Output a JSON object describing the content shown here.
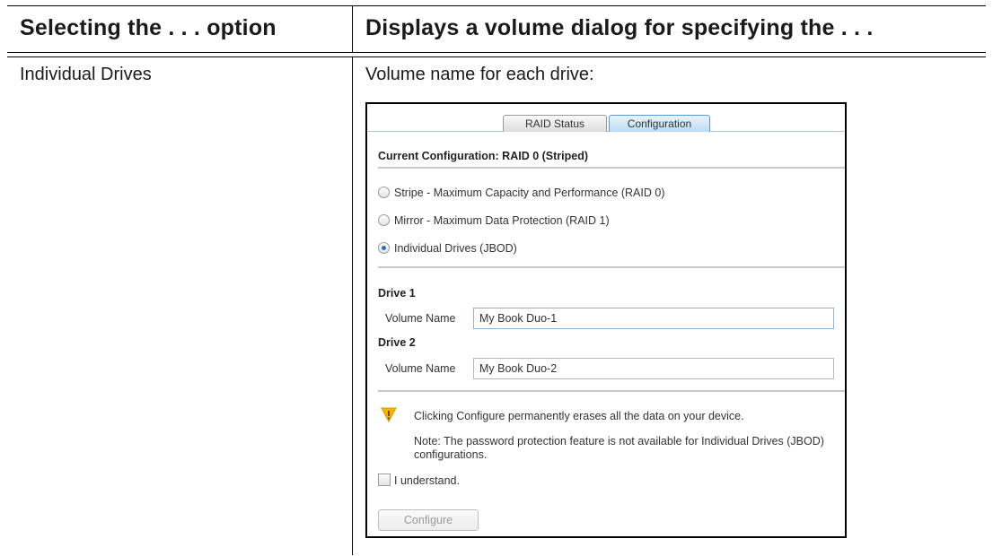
{
  "table": {
    "headers": [
      "Selecting the . . . option",
      "Displays a volume dialog for specifying the . . ."
    ],
    "row": {
      "option": "Individual Drives",
      "description": "Volume name for each drive:"
    }
  },
  "dialog": {
    "tabs": [
      {
        "label": "RAID Status",
        "active": false
      },
      {
        "label": "Configuration",
        "active": true
      }
    ],
    "current_configuration": "Current Configuration:  RAID 0 (Striped)",
    "raid_options": [
      {
        "label": "Stripe - Maximum Capacity and Performance (RAID 0)",
        "selected": false
      },
      {
        "label": "Mirror - Maximum Data Protection (RAID 1)",
        "selected": false
      },
      {
        "label": "Individual Drives (JBOD)",
        "selected": true
      }
    ],
    "drives": [
      {
        "title": "Drive 1",
        "volume_label": "Volume Name",
        "volume_value": "My Book Duo-1"
      },
      {
        "title": "Drive 2",
        "volume_label": "Volume Name",
        "volume_value": "My Book Duo-2"
      }
    ],
    "warning_icon": "warning-icon",
    "warning_color": "#f5b400",
    "warning": "Clicking Configure permanently erases all the data on your device.",
    "note": "Note: The password protection feature is not available for Individual Drives (JBOD) configurations.",
    "understand_label": "I understand.",
    "understand_checked": false,
    "configure_label": "Configure",
    "accent_color": "#5a9ad2"
  }
}
